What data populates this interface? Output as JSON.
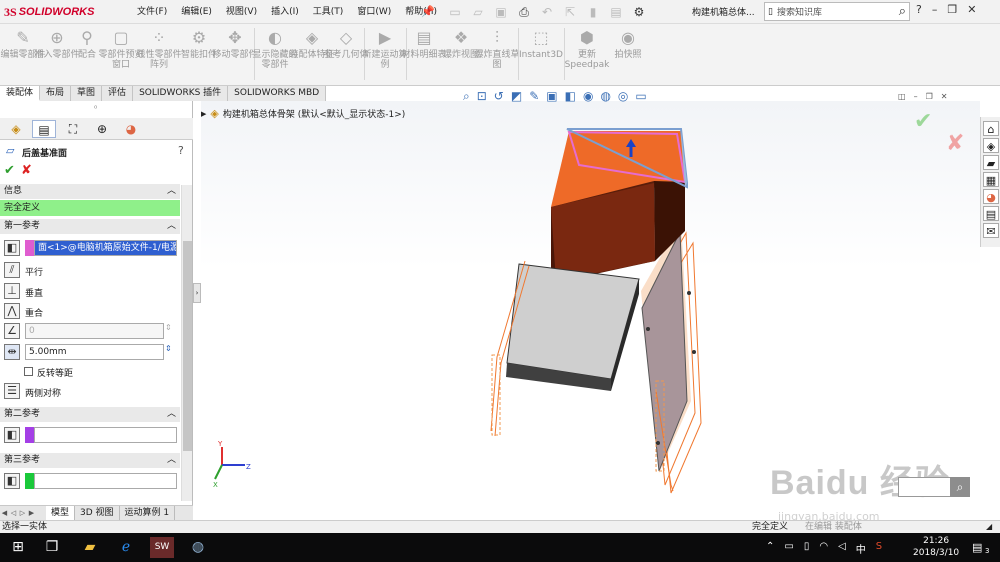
{
  "app": {
    "logo_ds": "3S",
    "logo_name": "SOLIDWORKS",
    "doc_title": "构建机箱总体..."
  },
  "menus": [
    "文件(F)",
    "编辑(E)",
    "视图(V)",
    "插入(I)",
    "工具(T)",
    "窗口(W)",
    "帮助(H)"
  ],
  "search": {
    "placeholder": "搜索知识库"
  },
  "ribbon": [
    {
      "label": "编辑零部件",
      "icon": "edit-component-icon"
    },
    {
      "label": "插入零部件",
      "icon": "insert-component-icon"
    },
    {
      "label": "配合",
      "icon": "mate-icon"
    },
    {
      "label": "零部件预览窗口",
      "icon": "preview-window-icon"
    },
    {
      "label": "线性零部件阵列",
      "icon": "linear-pattern-icon"
    },
    {
      "label": "智能扣件",
      "icon": "smart-fastener-icon"
    },
    {
      "label": "移动零部件",
      "icon": "move-component-icon"
    },
    {
      "label": "显示隐藏的零部件",
      "icon": "show-hidden-icon"
    },
    {
      "label": "装配体特征",
      "icon": "assembly-feature-icon"
    },
    {
      "label": "参考几何体",
      "icon": "reference-geometry-icon"
    },
    {
      "label": "新建运动算例",
      "icon": "motion-study-icon"
    },
    {
      "label": "材料明细表",
      "icon": "bom-icon"
    },
    {
      "label": "爆炸视图",
      "icon": "exploded-view-icon"
    },
    {
      "label": "爆炸直线草图",
      "icon": "explode-line-sketch-icon"
    },
    {
      "label": "Instant3D",
      "icon": "instant3d-icon"
    },
    {
      "label": "更新Speedpak",
      "icon": "speedpak-icon"
    },
    {
      "label": "拍快照",
      "icon": "snapshot-icon"
    }
  ],
  "tabs": [
    "装配体",
    "布局",
    "草图",
    "评估",
    "SOLIDWORKS 插件",
    "SOLIDWORKS MBD"
  ],
  "pm": {
    "title": "后盖基准面",
    "help": "?",
    "info_header": "信息",
    "status": "完全定义",
    "status_color": "#8ff08a",
    "first_ref_header": "第一参考",
    "first_ref_value": "面<1>@电脑机箱原始文件-1/电源-",
    "first_ref_color": "#e05dd0",
    "parallel": "平行",
    "perpendicular": "垂直",
    "coincident": "重合",
    "angle_value": "0",
    "distance_value": "5.00mm",
    "flip_offset": "反转等距",
    "symmetric": "两侧对称",
    "second_ref_header": "第二参考",
    "second_ref_color": "#a43fe6",
    "third_ref_header": "第三参考",
    "third_ref_color": "#1ac93a"
  },
  "bottom_tabs": [
    "模型",
    "3D 视图",
    "运动算例 1"
  ],
  "status_left": "选择一实体",
  "status_right": "完全定义",
  "status_edit": "在编辑 装配体",
  "viewport": {
    "tree_label": "构建机箱总体骨架 (默认<默认_显示状态-1>)"
  },
  "taskbar": {
    "time": "21:26",
    "date": "2018/3/10",
    "ime": "中",
    "notify": "3"
  },
  "watermark": {
    "main": "Baidu 经验",
    "sub": "jingyan.baidu.com"
  }
}
